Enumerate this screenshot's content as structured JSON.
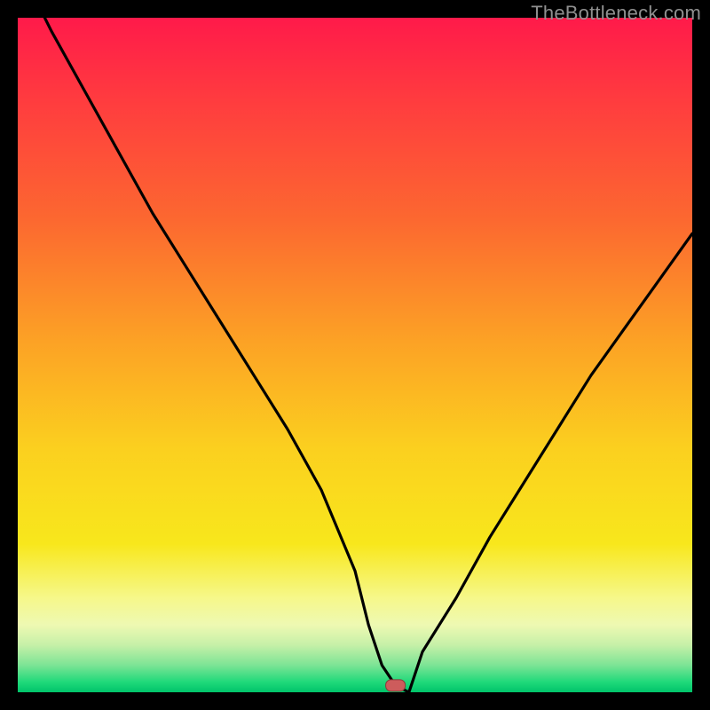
{
  "watermark": "TheBottleneck.com",
  "colors": {
    "gradient_top": "#ff1744",
    "gradient_mid": "#fca225",
    "gradient_low": "#f8e71c",
    "gradient_green1": "#b8e986",
    "gradient_green2": "#00e676",
    "curve": "#000000",
    "marker_fill": "#cd5c5c",
    "marker_stroke": "#8b3a3a",
    "frame": "#000000"
  },
  "chart_data": {
    "type": "line",
    "title": "",
    "xlabel": "",
    "ylabel": "",
    "xlim": [
      0,
      100
    ],
    "ylim": [
      0,
      100
    ],
    "series": [
      {
        "name": "bottleneck-curve",
        "x": [
          0,
          5,
          10,
          15,
          20,
          25,
          30,
          35,
          40,
          45,
          50,
          52,
          54,
          56,
          58,
          60,
          65,
          70,
          75,
          80,
          85,
          90,
          95,
          100
        ],
        "values": [
          108,
          98,
          89,
          80,
          71,
          63,
          55,
          47,
          39,
          30,
          18,
          10,
          4,
          1,
          0,
          6,
          14,
          23,
          31,
          39,
          47,
          54,
          61,
          68
        ]
      }
    ],
    "marker": {
      "x": 56,
      "y": 1
    },
    "gradient_bands_percent": {
      "red_to_orange": [
        0,
        55
      ],
      "orange_to_yellow": [
        55,
        82
      ],
      "pale_yellow": [
        82,
        90
      ],
      "pale_green": [
        90,
        94
      ],
      "green": [
        94,
        99
      ],
      "baseline_green": [
        99,
        100
      ]
    }
  }
}
